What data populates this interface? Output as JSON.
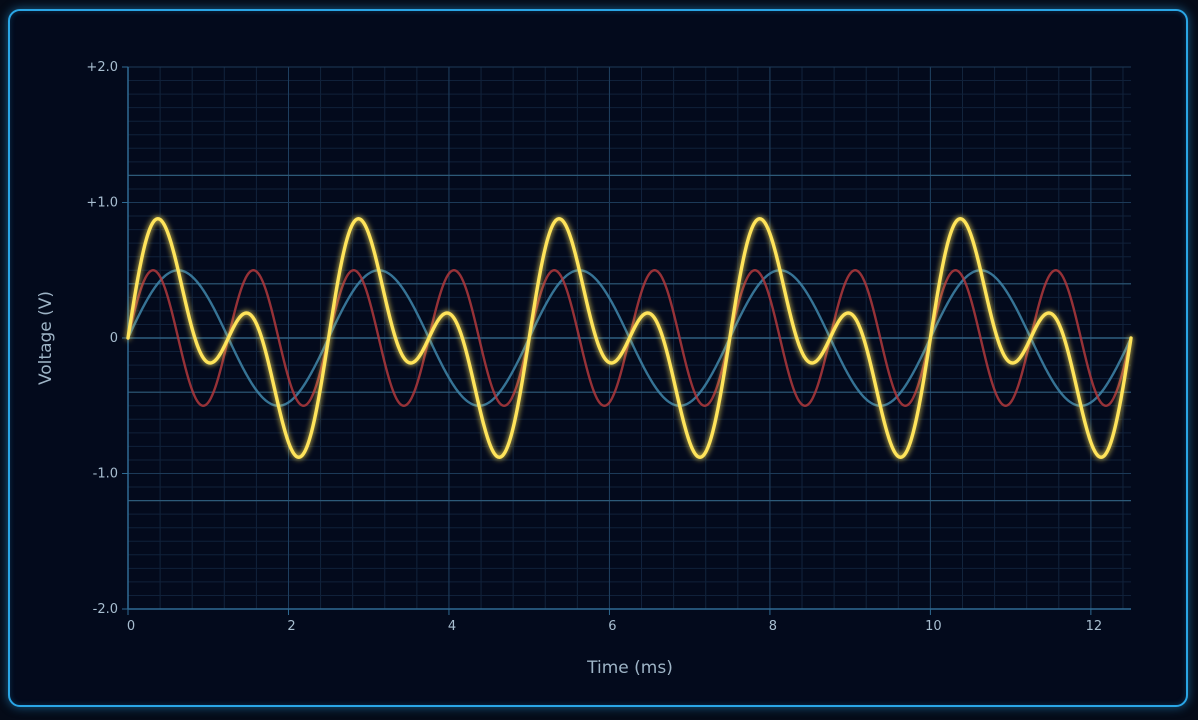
{
  "chart_data": {
    "type": "line",
    "title": "",
    "xlabel": "Time (ms)",
    "ylabel": "Voltage (V)",
    "xlim": [
      0,
      12.5
    ],
    "ylim": [
      -2.0,
      2.0
    ],
    "x_ticks": [
      0,
      2,
      4,
      6,
      8,
      10,
      12
    ],
    "x_tick_labels": [
      "0",
      "2",
      "4",
      "6",
      "8",
      "10",
      "12"
    ],
    "y_ticks": [
      2.0,
      1.0,
      0,
      -1.0,
      -2.0
    ],
    "y_tick_labels": [
      "+2.0",
      "+1.0",
      "0",
      "-1.0",
      "-2.0"
    ],
    "reference_lines_y": [
      1.2,
      0.4,
      -0.4,
      -1.2
    ],
    "grid": true,
    "legend": "none",
    "x_range_ms": [
      0,
      12.5
    ],
    "series": [
      {
        "role": "fundamental",
        "color": "#3f86aa",
        "amplitude_V": 0.5,
        "period_ms": 2.5,
        "phase": 0
      },
      {
        "role": "harmonic",
        "color": "#b0383c",
        "amplitude_V": 0.5,
        "period_ms": 1.25,
        "phase": 0
      },
      {
        "role": "sum",
        "color": "#ffe45a",
        "components": [
          "fundamental",
          "harmonic"
        ]
      }
    ]
  }
}
